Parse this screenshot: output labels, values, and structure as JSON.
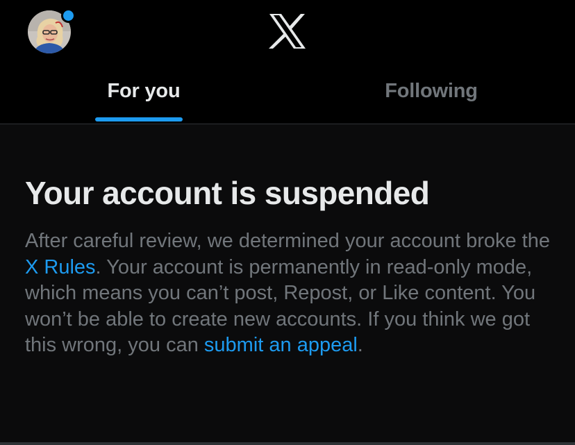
{
  "header": {
    "logo_icon": "x-logo-icon",
    "avatar_icon": "profile-avatar",
    "notification_dot_color": "#1d9bf0"
  },
  "tabs": [
    {
      "label": "For you",
      "active": true
    },
    {
      "label": "Following",
      "active": false
    }
  ],
  "notice": {
    "title": "Your account is suspended",
    "part1": "After careful review, we determined your account broke the ",
    "rules_link": "X Rules",
    "part2": ". Your account is permanently in read-only mode, which means you can’t post, Repost, or Like content. You won’t be able to create new accounts. If you think we got this wrong, you can ",
    "appeal_link": "submit an appeal",
    "part3": "."
  },
  "colors": {
    "background": "#000000",
    "accent": "#1d9bf0",
    "text_primary": "#e7e9ea",
    "text_secondary": "#71767b",
    "divider": "#2f3336"
  }
}
